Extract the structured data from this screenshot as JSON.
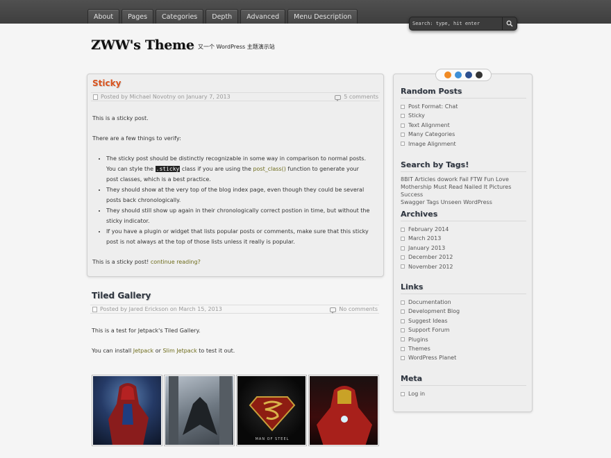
{
  "nav": {
    "tabs": [
      "About",
      "Pages",
      "Categories",
      "Depth",
      "Advanced",
      "Menu Description"
    ]
  },
  "search": {
    "placeholder": "Search: type, hit enter",
    "icon": "search-icon"
  },
  "site": {
    "title": "ZWW's Theme",
    "description": "又一个 WordPress 主题演示站"
  },
  "posts": [
    {
      "title": "Sticky",
      "meta_author": "Posted by Michael Novotny on January 7, 2013",
      "meta_comments": "5 comments",
      "intro": "This is a sticky post.",
      "lead": "There are a few things to verify:",
      "li1_a": "The sticky post should be distinctly recognizable in some way in comparison to normal posts. You can style the ",
      "li1_code": ".sticky",
      "li1_b": " class if you are using the ",
      "li1_link": "post_class()",
      "li1_c": " function to generate your post classes, which is a best practice.",
      "li2": "They should show at the very top of the blog index page, even though they could be several posts back chronologically.",
      "li3": "They should still show up again in their chronologically correct postion in time, but without the sticky indicator.",
      "li4": "If you have a plugin or widget that lists popular posts or comments, make sure that this sticky post is not always at the top of those lists unless it really is popular.",
      "outro": "This is a sticky post! ",
      "more": "continue reading?"
    },
    {
      "title": "Tiled Gallery",
      "meta_author": "Posted by Jared Erickson on March 15, 2013",
      "meta_comments": "No comments",
      "p1": "This is a test for Jetpack's Tiled Gallery.",
      "p2_a": "You can install ",
      "p2_link1": "Jetpack",
      "p2_b": " or ",
      "p2_link2": "Slim Jetpack",
      "p2_c": " to test it out.",
      "thumbs": [
        "spider-man-image",
        "batman-image",
        "man-of-steel-image",
        "iron-man-image"
      ],
      "thumb_text": "MAN OF STEEL"
    }
  ],
  "sidebar": {
    "social": [
      "rss-icon",
      "weibo-icon",
      "facebook-icon",
      "github-icon"
    ],
    "random_posts": {
      "title": "Random Posts",
      "items": [
        "Post Format: Chat",
        "Sticky",
        "Text Alignment",
        "Many Categories",
        "Image Alignment"
      ]
    },
    "tags": {
      "title": "Search by Tags!",
      "line1": "8BIT Articles dowork Fail FTW Fun Love",
      "line2": "Mothership Must Read Nailed It Pictures Success",
      "line3": "Swagger Tags Unseen WordPress"
    },
    "archives": {
      "title": "Archives",
      "items": [
        "February 2014",
        "March 2013",
        "January 2013",
        "December 2012",
        "November 2012"
      ]
    },
    "links": {
      "title": "Links",
      "items": [
        "Documentation",
        "Development Blog",
        "Suggest Ideas",
        "Support Forum",
        "Plugins",
        "Themes",
        "WordPress Planet"
      ]
    },
    "meta": {
      "title": "Meta",
      "items": [
        "Log in"
      ]
    }
  }
}
